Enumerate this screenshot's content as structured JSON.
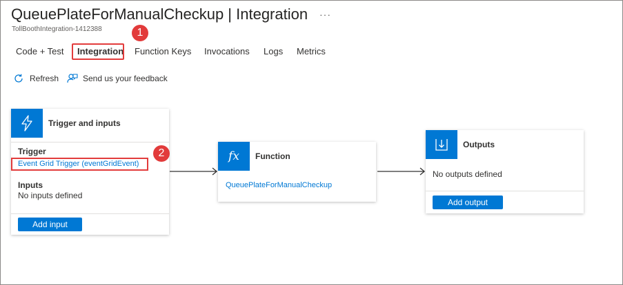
{
  "header": {
    "title": "QueuePlateForManualCheckup | Integration",
    "ellipsis": "···",
    "subtitle": "TollBoothIntegration-1412388"
  },
  "tabs": [
    {
      "label": "Code + Test",
      "active": false
    },
    {
      "label": "Integration",
      "active": true
    },
    {
      "label": "Function Keys",
      "active": false
    },
    {
      "label": "Invocations",
      "active": false
    },
    {
      "label": "Logs",
      "active": false
    },
    {
      "label": "Metrics",
      "active": false
    }
  ],
  "callouts": {
    "first": "1",
    "second": "2"
  },
  "toolbar": {
    "refresh_label": "Refresh",
    "feedback_label": "Send us your feedback"
  },
  "trigger_card": {
    "title": "Trigger and inputs",
    "trigger_heading": "Trigger",
    "trigger_link": "Event Grid Trigger (eventGridEvent)",
    "inputs_heading": "Inputs",
    "inputs_value": "No inputs defined",
    "add_button": "Add input",
    "icon": "lightning-icon"
  },
  "function_card": {
    "title": "Function",
    "icon_text": "fx",
    "function_link": "QueuePlateForManualCheckup"
  },
  "outputs_card": {
    "title": "Outputs",
    "outputs_value": "No outputs defined",
    "add_button": "Add output",
    "icon": "output-arrow-icon"
  },
  "colors": {
    "accent": "#0078d4",
    "highlight": "#e23b3b",
    "text": "#323130"
  }
}
